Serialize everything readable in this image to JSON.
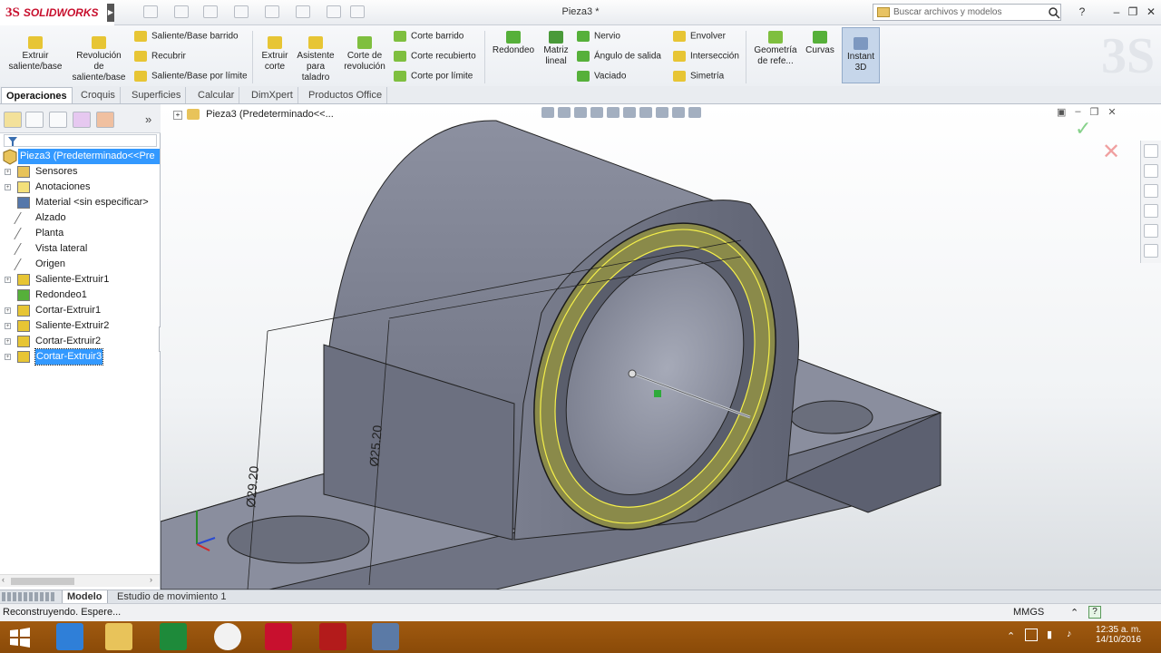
{
  "app": {
    "brand_ds": "3S",
    "brand_name": "SOLIDWORKS",
    "doc_title": "Pieza3 *"
  },
  "search": {
    "placeholder": "Buscar archivos y modelos"
  },
  "ribbon": {
    "extrude": "Extruir saliente/base",
    "revolve": "Revolución de saliente/base",
    "sweep": "Saliente/Base barrido",
    "loft": "Recubrir",
    "boundary": "Saliente/Base por límite",
    "extruded_cut": "Extruir corte",
    "hole_wizard": "Asistente para taladro",
    "revolved_cut": "Corte de revolución",
    "swept_cut": "Corte barrido",
    "lofted_cut": "Corte recubierto",
    "boundary_cut": "Corte por límite",
    "fillet": "Redondeo",
    "linear_pattern": "Matriz lineal",
    "rib": "Nervio",
    "draft": "Ángulo de salida",
    "shell": "Vaciado",
    "wrap": "Envolver",
    "intersect": "Intersección",
    "mirror": "Simetría",
    "ref_geometry": "Geometría de refe...",
    "curves": "Curvas",
    "instant3d": "Instant 3D"
  },
  "tabs": [
    "Operaciones",
    "Croquis",
    "Superficies",
    "Calcular",
    "DimXpert",
    "Productos Office"
  ],
  "tree": {
    "root": "Pieza3  (Predeterminado<<Pre",
    "items": [
      {
        "label": "Sensores",
        "icon": "sensor-icon"
      },
      {
        "label": "Anotaciones",
        "icon": "annotation-icon"
      },
      {
        "label": "Material <sin especificar>",
        "icon": "material-icon"
      },
      {
        "label": "Alzado",
        "icon": "plane-icon"
      },
      {
        "label": "Planta",
        "icon": "plane-icon"
      },
      {
        "label": "Vista lateral",
        "icon": "plane-icon"
      },
      {
        "label": "Origen",
        "icon": "origin-icon"
      },
      {
        "label": "Saliente-Extruir1",
        "icon": "extrude-icon"
      },
      {
        "label": "Redondeo1",
        "icon": "fillet-icon"
      },
      {
        "label": "Cortar-Extruir1",
        "icon": "cut-icon"
      },
      {
        "label": "Saliente-Extruir2",
        "icon": "extrude-icon"
      },
      {
        "label": "Cortar-Extruir2",
        "icon": "cut-icon"
      },
      {
        "label": "Cortar-Extruir3",
        "icon": "cut-icon"
      }
    ]
  },
  "viewport": {
    "path": "Pieza3  (Predeterminado<<...",
    "dim1": "Ø29.20",
    "dim2": "Ø25.20"
  },
  "bottom_tabs": [
    "Modelo",
    "Estudio de movimiento 1"
  ],
  "status": {
    "message": "Reconstruyendo. Espere...",
    "units": "MMGS"
  },
  "taskbar": {
    "time": "12:35 a. m.",
    "date": "14/10/2016"
  },
  "colors": {
    "selection": "#3399ff",
    "brand": "#c8102e",
    "taskbar": "#9a5510",
    "model_face": "#6e7280",
    "highlight_ring": "#8a8a4a"
  }
}
